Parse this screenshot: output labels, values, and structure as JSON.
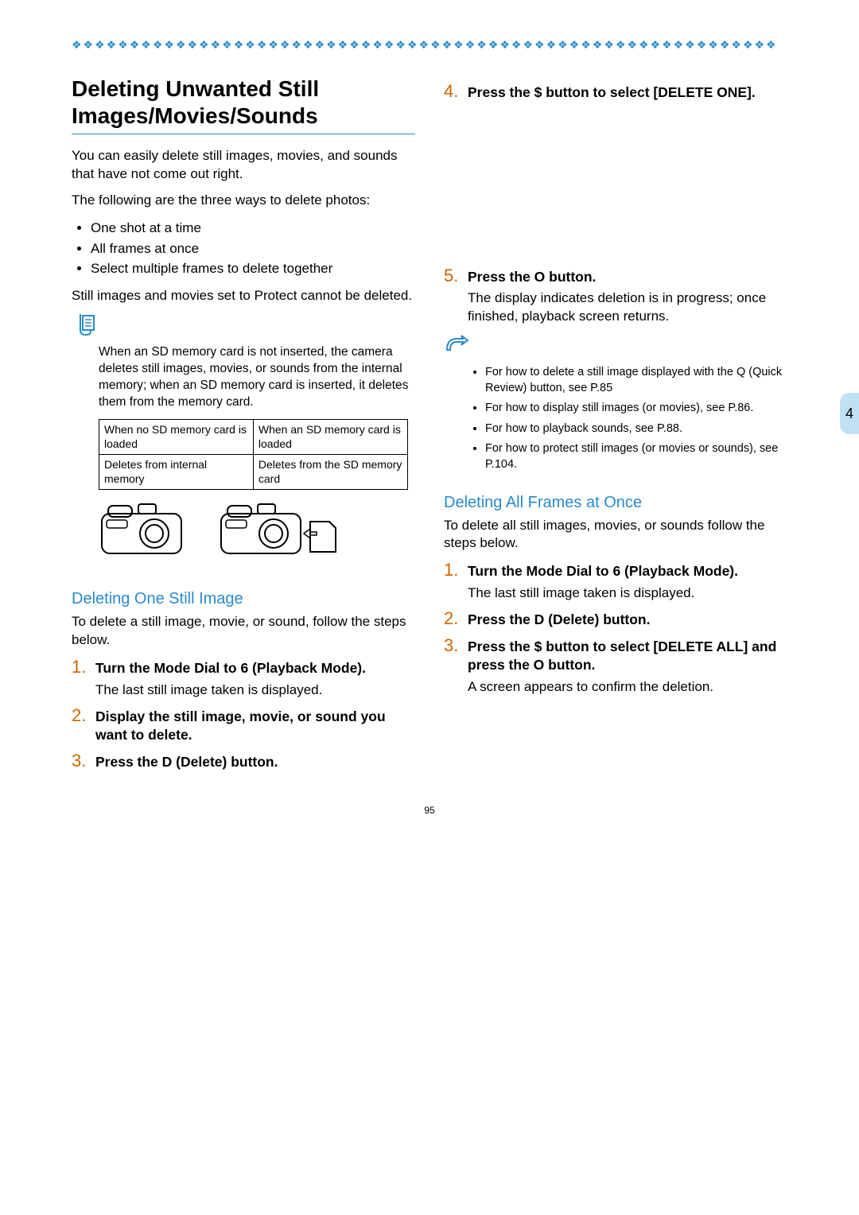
{
  "chapter_tab": "4",
  "page_number": "95",
  "left": {
    "title": "Deleting Unwanted Still Images/Movies/Sounds",
    "intro1": "You can easily delete still images, movies, and sounds that have not come out right.",
    "intro2": "The following are the three ways to delete photos:",
    "bullets": [
      "One shot at a time",
      "All frames at once",
      "Select multiple frames to delete together"
    ],
    "protect_note": "Still images and movies set to Protect cannot be deleted.",
    "memo_text": "When an SD memory card is not inserted, the camera deletes still images, movies, or sounds from the internal memory; when an SD memory card is inserted, it deletes them from the memory card.",
    "table": {
      "r1c1": "When no SD memory card is loaded",
      "r1c2": "When an SD memory card is loaded",
      "r2c1": "Deletes from internal memory",
      "r2c2": "Deletes from the SD memory card"
    },
    "subhead": "Deleting One Still Image",
    "sub_intro": "To delete a still image, movie, or sound, follow the steps below.",
    "steps": {
      "s1_num": "1.",
      "s1_title": "Turn the Mode Dial to 6 (Playback Mode).",
      "s1_body": "The last still image taken is displayed.",
      "s2_num": "2.",
      "s2_title": "Display the still image, movie, or sound you want to delete.",
      "s3_num": "3.",
      "s3_title": "Press the D (Delete) button."
    }
  },
  "right": {
    "steps": {
      "s4_num": "4.",
      "s4_title": "Press the $ button to select [DELETE ONE].",
      "s5_num": "5.",
      "s5_title": "Press the O button.",
      "s5_body": "The display indicates deletion is in progress; once finished, playback screen returns."
    },
    "ref_notes": [
      "For how to delete a still image displayed with the Q (Quick Review) button, see P.85",
      "For how to display still images (or movies), see P.86.",
      "For how to playback sounds, see P.88.",
      "For how to protect still images (or movies or sounds), see P.104."
    ],
    "subhead2": "Deleting All Frames at Once",
    "sub2_intro": "To delete all still images, movies, or sounds follow the steps below.",
    "steps2": {
      "s1_num": "1.",
      "s1_title": "Turn the Mode Dial to 6 (Playback Mode).",
      "s1_body": "The last still image taken is displayed.",
      "s2_num": "2.",
      "s2_title": "Press the D (Delete) button.",
      "s3_num": "3.",
      "s3_title": "Press the $ button to select [DELETE ALL] and press the O button.",
      "s3_body": "A screen appears to confirm the deletion."
    }
  }
}
